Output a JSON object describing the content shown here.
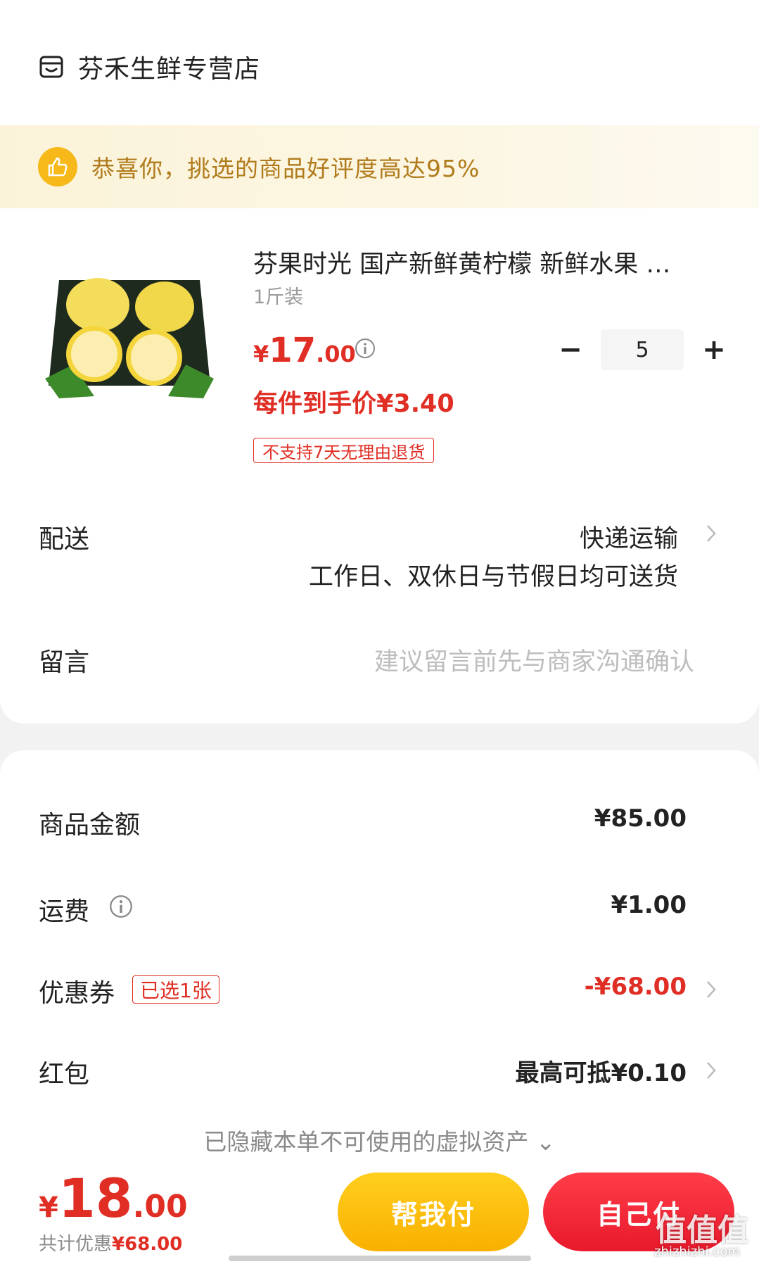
{
  "store": {
    "name": "芬禾生鲜专营店",
    "icon": "store-icon"
  },
  "banner": {
    "text": "恭喜你，挑选的商品好评度高达95%",
    "icon": "thumbs-up-icon"
  },
  "product": {
    "title": "芬果时光 国产新鲜黄柠檬 新鲜水果 …",
    "spec": "1斤装",
    "price_symbol": "¥",
    "price_int": "17",
    "price_dec": ".00",
    "quantity": "5",
    "minus": "−",
    "plus": "+",
    "unit_price": "每件到手价¥3.40",
    "return_tag": "不支持7天无理由退货"
  },
  "delivery": {
    "label": "配送",
    "method": "快递运输",
    "note": "工作日、双休日与节假日均可送货"
  },
  "message": {
    "label": "留言",
    "placeholder": "建议留言前先与商家沟通确认"
  },
  "summary": {
    "goods_label": "商品金额",
    "goods_amount": "¥85.00",
    "shipping_label": "运费",
    "shipping_amount": "¥1.00",
    "coupon_label": "优惠券",
    "coupon_tag": "已选1张",
    "coupon_amount": "-¥68.00",
    "redpacket_label": "红包",
    "redpacket_hint": "最高可抵¥0.10",
    "hidden_assets": "已隐藏本单不可使用的虚拟资产 ⌄"
  },
  "footer": {
    "total_symbol": "¥",
    "total_int": "18",
    "total_dec": ".00",
    "saved_prefix": "共计优惠",
    "saved_amount": "¥68.00",
    "help_pay": "帮我付",
    "self_pay": "自己付"
  },
  "watermark": {
    "main": "值值值",
    "sub": "zhizhizhi.com"
  },
  "colors": {
    "accent_red": "#e02e24",
    "accent_yellow": "#f9b000",
    "banner_text": "#b07b1b"
  }
}
